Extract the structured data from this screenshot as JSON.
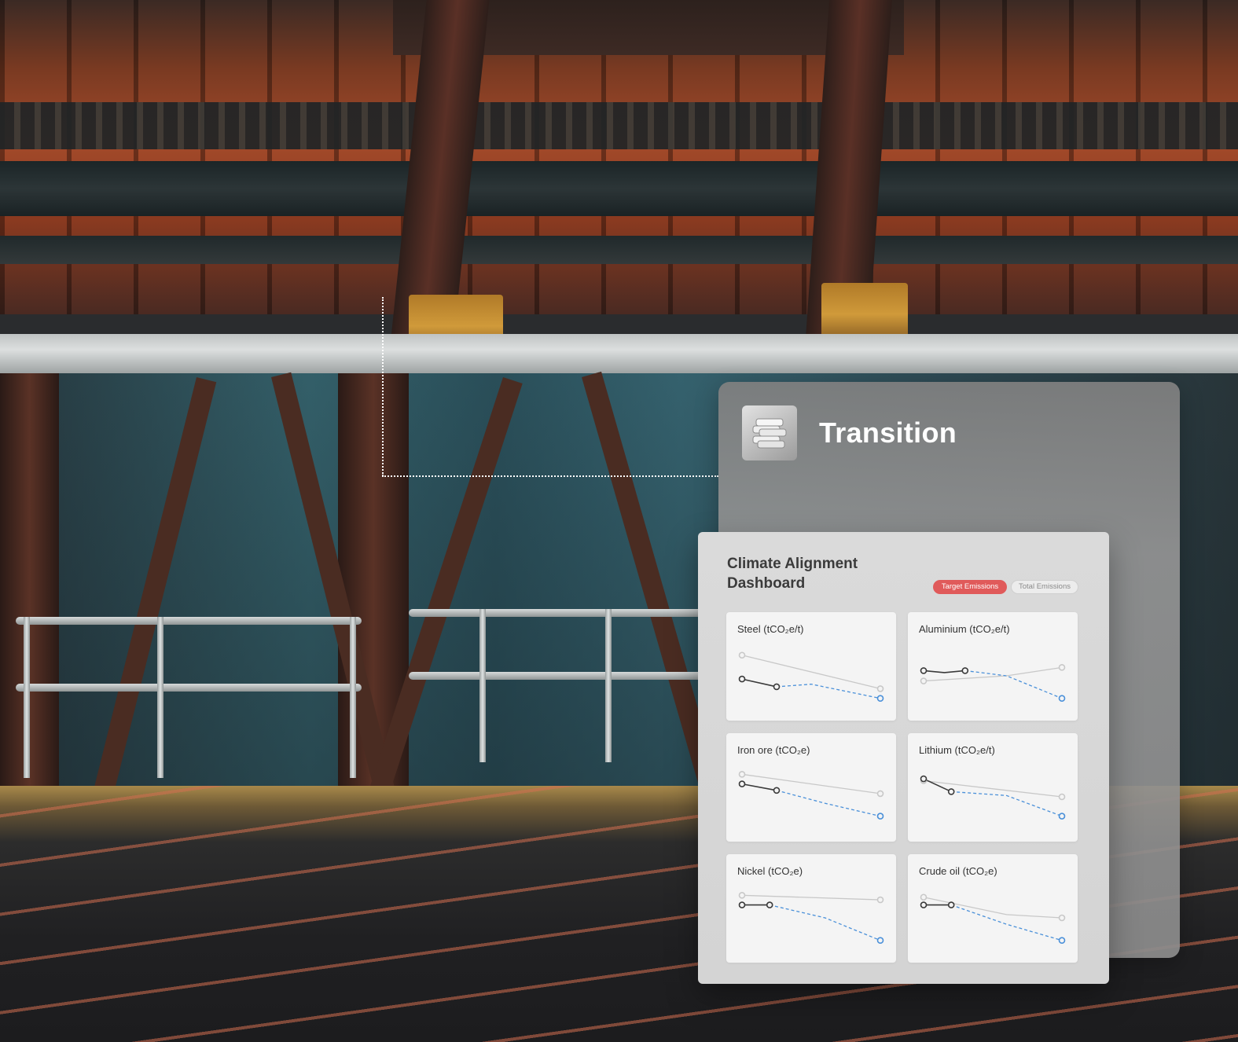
{
  "card": {
    "title": "Transition",
    "icon": "metal-bars-icon"
  },
  "dashboard": {
    "title": "Climate Alignment Dashboard",
    "toggle": {
      "active_label": "Target Emissions",
      "inactive_label": "Total Emissions",
      "active_color": "#e05a5a"
    },
    "series_colors": {
      "total": "#c8c8c8",
      "actual": "#3a3a3a",
      "target": "#4a90d9"
    },
    "metrics": [
      {
        "label": "Steel (tCO₂e/t)",
        "total": [
          [
            0,
            0.82
          ],
          [
            1,
            0.3
          ]
        ],
        "actual": [
          [
            0,
            0.45
          ],
          [
            0.25,
            0.33
          ]
        ],
        "target": [
          [
            0.25,
            0.33
          ],
          [
            0.5,
            0.37
          ],
          [
            1,
            0.15
          ]
        ]
      },
      {
        "label": "Aluminium (tCO₂e/t)",
        "total": [
          [
            0,
            0.42
          ],
          [
            0.6,
            0.5
          ],
          [
            1,
            0.63
          ]
        ],
        "actual": [
          [
            0,
            0.58
          ],
          [
            0.15,
            0.55
          ],
          [
            0.3,
            0.58
          ]
        ],
        "target": [
          [
            0.3,
            0.58
          ],
          [
            0.6,
            0.5
          ],
          [
            1,
            0.15
          ]
        ]
      },
      {
        "label": "Iron ore (tCO₂e)",
        "total": [
          [
            0,
            0.85
          ],
          [
            1,
            0.55
          ]
        ],
        "actual": [
          [
            0,
            0.7
          ],
          [
            0.25,
            0.6
          ]
        ],
        "target": [
          [
            0.25,
            0.6
          ],
          [
            0.6,
            0.4
          ],
          [
            1,
            0.2
          ]
        ]
      },
      {
        "label": "Lithium (tCO₂e/t)",
        "total": [
          [
            0,
            0.75
          ],
          [
            1,
            0.5
          ]
        ],
        "actual": [
          [
            0,
            0.78
          ],
          [
            0.2,
            0.58
          ]
        ],
        "target": [
          [
            0.2,
            0.58
          ],
          [
            0.6,
            0.52
          ],
          [
            1,
            0.2
          ]
        ]
      },
      {
        "label": "Nickel (tCO₂e)",
        "total": [
          [
            0,
            0.85
          ],
          [
            1,
            0.78
          ]
        ],
        "actual": [
          [
            0,
            0.7
          ],
          [
            0.2,
            0.7
          ]
        ],
        "target": [
          [
            0.2,
            0.7
          ],
          [
            0.6,
            0.5
          ],
          [
            1,
            0.15
          ]
        ]
      },
      {
        "label": "Crude oil (tCO₂e)",
        "total": [
          [
            0,
            0.82
          ],
          [
            0.6,
            0.55
          ],
          [
            1,
            0.5
          ]
        ],
        "actual": [
          [
            0,
            0.7
          ],
          [
            0.2,
            0.7
          ]
        ],
        "target": [
          [
            0.2,
            0.7
          ],
          [
            0.6,
            0.4
          ],
          [
            1,
            0.15
          ]
        ]
      }
    ]
  }
}
